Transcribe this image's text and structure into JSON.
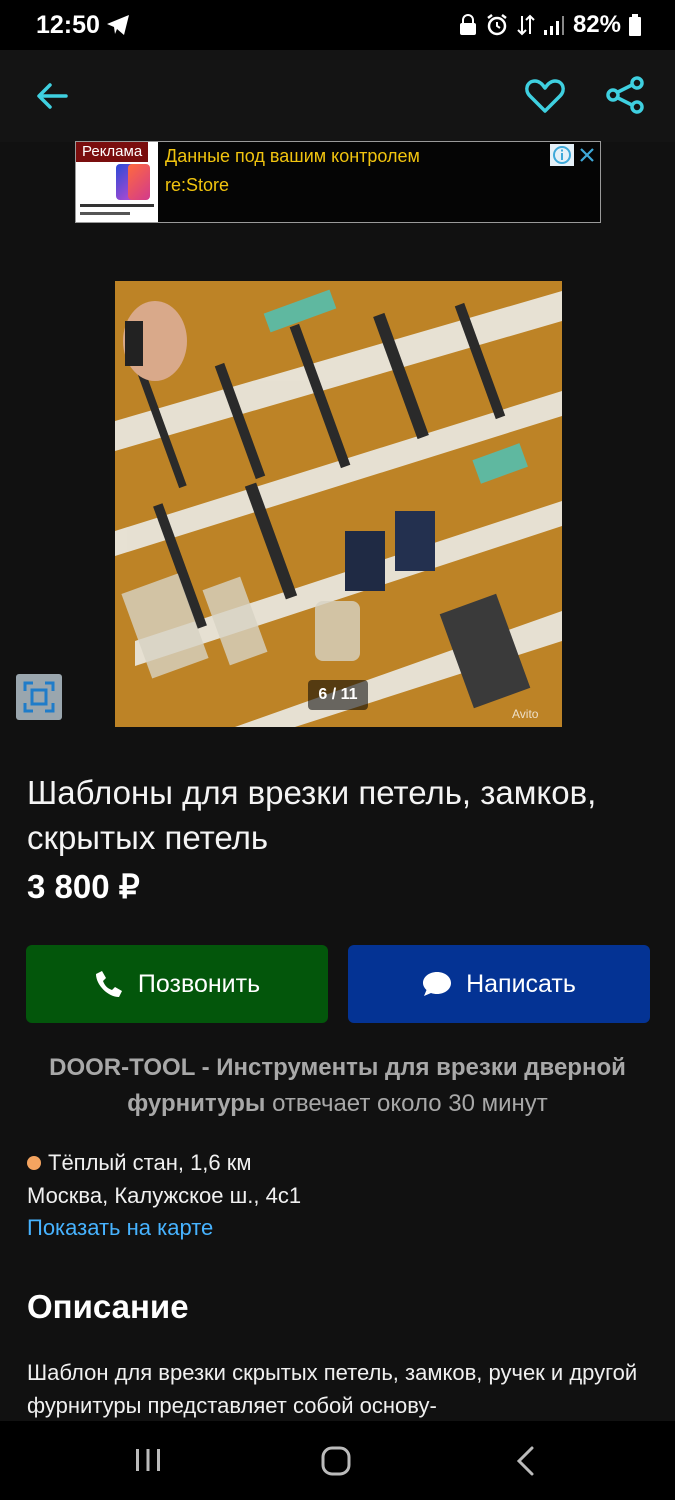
{
  "status_bar": {
    "time": "12:50",
    "battery": "82%"
  },
  "app_bar": {
    "accent_color": "#3fd0e0",
    "icons": [
      "back-arrow-icon",
      "heart-icon",
      "share-icon"
    ]
  },
  "ad": {
    "label": "Реклама",
    "title": "Данные под вашим контролем",
    "brand": "re:Store"
  },
  "gallery": {
    "counter": "6 / 11",
    "watermark": "Avito"
  },
  "listing": {
    "title": "Шаблоны для врезки петель, замков, скрытых петель",
    "price": "3 800 ₽"
  },
  "actions": {
    "call_label": "Позвонить",
    "call_color": "#03560b",
    "message_label": "Написать",
    "message_color": "#043394"
  },
  "seller": {
    "name": "DOOR-TOOL - Инструменты для врезки дверной фурнитуры",
    "response": "отвечает около 30 минут"
  },
  "location": {
    "metro": "Тёплый стан, 1,6 км",
    "metro_color": "#f4a460",
    "address": "Москва, Калужское ш., 4с1",
    "map_link": "Показать на карте"
  },
  "description": {
    "heading": "Описание",
    "text": "Шаблон для врезки скрытых петель, замков, ручек и другой фурнитуры представляет собой основу-"
  }
}
